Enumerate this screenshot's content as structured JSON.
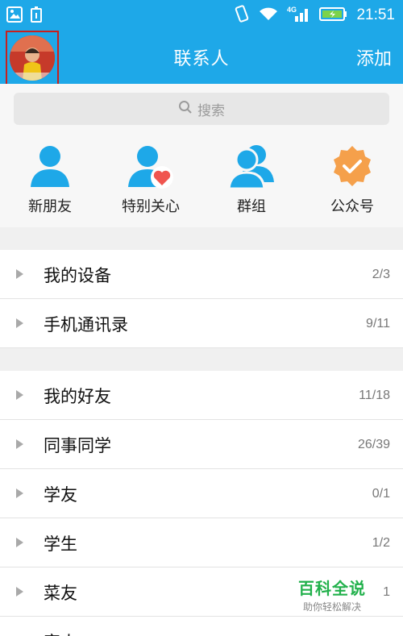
{
  "status_bar": {
    "time": "21:51",
    "network": "4G"
  },
  "header": {
    "title": "联系人",
    "add_label": "添加"
  },
  "search": {
    "placeholder": "搜索"
  },
  "quick_actions": [
    {
      "label": "新朋友",
      "icon": "person-icon"
    },
    {
      "label": "特别关心",
      "icon": "person-heart-icon"
    },
    {
      "label": "群组",
      "icon": "group-icon"
    },
    {
      "label": "公众号",
      "icon": "badge-check-icon"
    }
  ],
  "groups_top": [
    {
      "name": "我的设备",
      "count": "2/3"
    },
    {
      "name": "手机通讯录",
      "count": "9/11"
    }
  ],
  "groups_main": [
    {
      "name": "我的好友",
      "count": "11/18"
    },
    {
      "name": "同事同学",
      "count": "26/39"
    },
    {
      "name": "学友",
      "count": "0/1"
    },
    {
      "name": "学生",
      "count": "1/2"
    },
    {
      "name": "菜友",
      "count": "1"
    },
    {
      "name": "家人",
      "count": ""
    }
  ],
  "watermark": {
    "main": "百科全说",
    "sub": "助你轻松解决"
  },
  "colors": {
    "header_bg": "#1ea8e8",
    "icon_blue": "#1ea8e8",
    "heart_red": "#f0554f",
    "badge_orange": "#f5a04b",
    "highlight_border": "#c8201d"
  }
}
